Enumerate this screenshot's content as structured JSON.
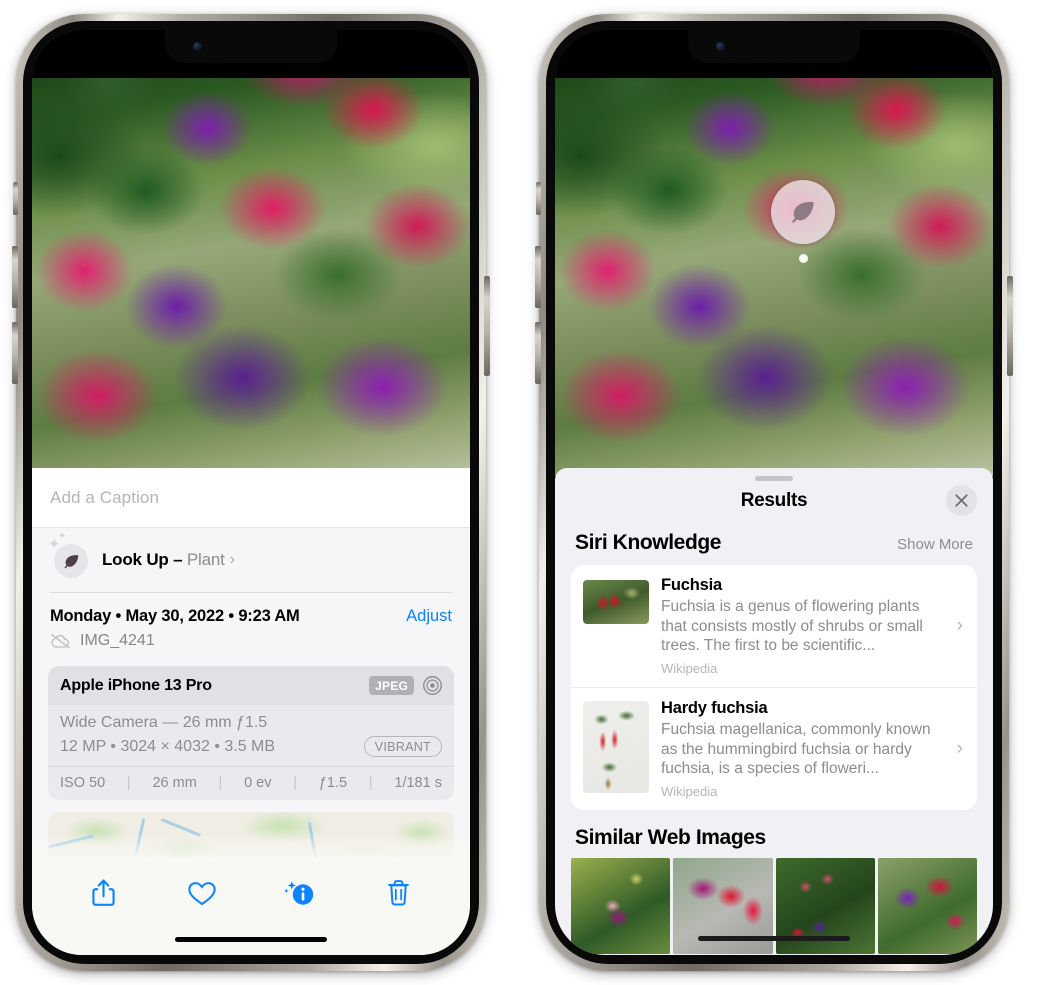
{
  "left_phone": {
    "caption_field": {
      "placeholder": "Add a Caption",
      "value": ""
    },
    "look_up": {
      "label": "Look Up – ",
      "subject": "Plant",
      "chevron": "›",
      "icon": "leaf-icon"
    },
    "metadata": {
      "date_line": "Monday • May 30, 2022 • 9:23 AM",
      "adjust_label": "Adjust",
      "filename": "IMG_4241",
      "cloud_icon": "cloud-slash-icon"
    },
    "exif": {
      "device": "Apple iPhone 13 Pro",
      "format_badge": "JPEG",
      "aperture_icon": "aperture-icon",
      "lens": "Wide Camera — 26 mm ƒ1.5",
      "dimensions": "12 MP • 3024 × 4032 • 3.5 MB",
      "style_badge": "VIBRANT",
      "stats": [
        "ISO 50",
        "26 mm",
        "0 ev",
        "ƒ1.5",
        "1/181 s"
      ]
    },
    "toolbar": [
      {
        "name": "share-icon",
        "label": "Share"
      },
      {
        "name": "heart-icon",
        "label": "Favorite"
      },
      {
        "name": "info-sparkle-icon",
        "label": "Info"
      },
      {
        "name": "trash-icon",
        "label": "Delete"
      }
    ]
  },
  "right_phone": {
    "vlu_badge": {
      "icon": "leaf-icon"
    },
    "sheet": {
      "title": "Results",
      "close_icon": "close-icon",
      "grabber": "sheet-grabber"
    },
    "siri_knowledge": {
      "title": "Siri Knowledge",
      "show_more": "Show More",
      "items": [
        {
          "title": "Fuchsia",
          "description": "Fuchsia is a genus of flowering plants that consists mostly of shrubs or small trees. The first to be scientific...",
          "source": "Wikipedia",
          "chevron": "›"
        },
        {
          "title": "Hardy fuchsia",
          "description": "Fuchsia magellanica, commonly known as the hummingbird fuchsia or hardy fuchsia, is a species of floweri...",
          "source": "Wikipedia",
          "chevron": "›"
        }
      ]
    },
    "similar_web_images": {
      "title": "Similar Web Images",
      "count": 4
    }
  },
  "colors": {
    "accent_blue": "#0b84fe",
    "sheet_bg": "#f1f1f5",
    "card_bg": "#ffffff",
    "secondary_text": "#8c8c91",
    "toolbar_bg": "#f8f8f4"
  }
}
